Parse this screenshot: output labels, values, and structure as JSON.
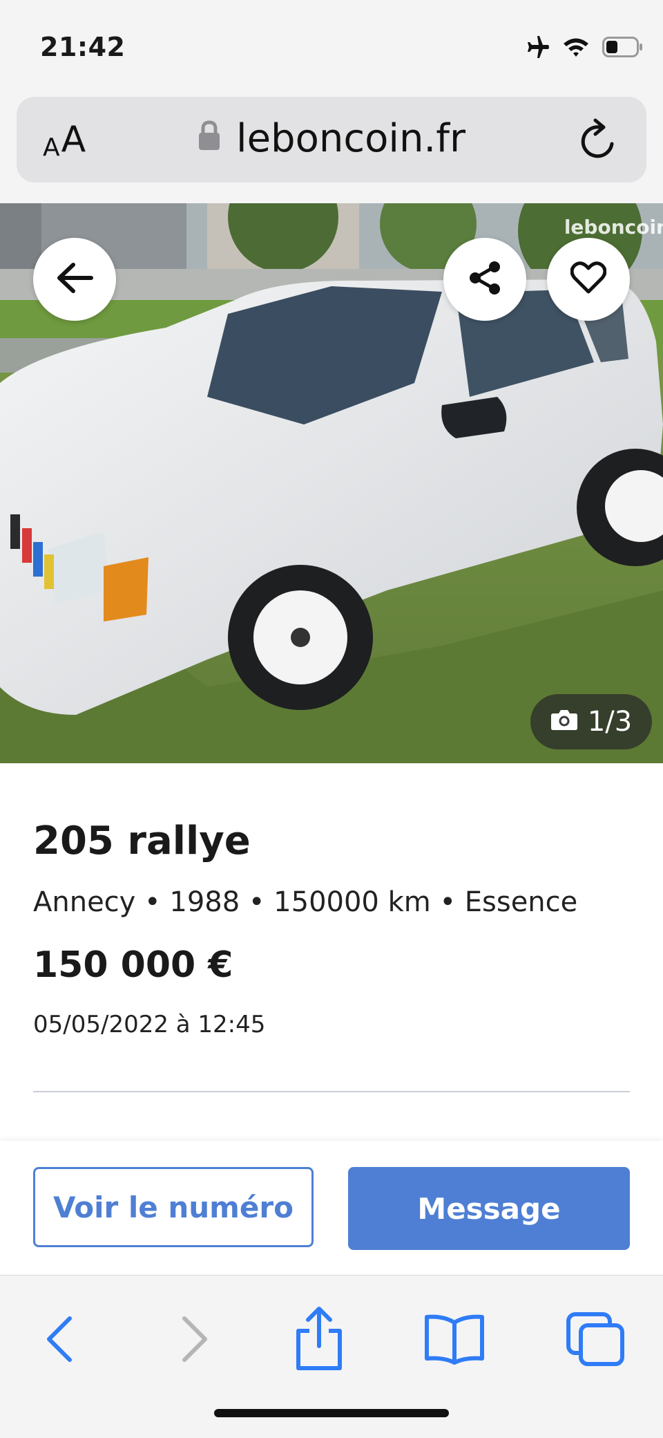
{
  "status_bar": {
    "time": "21:42"
  },
  "browser": {
    "text_size_small": "A",
    "text_size_big": "A",
    "domain": "leboncoin.fr"
  },
  "gallery": {
    "watermark": "leboncoin",
    "counter": "1/3"
  },
  "listing": {
    "title": "205 rallye",
    "meta": "Annecy • 1988 • 150000 km • Essence",
    "price": "150 000 €",
    "date": "05/05/2022 à 12:45"
  },
  "actions": {
    "show_number": "Voir le numéro",
    "message": "Message"
  },
  "colors": {
    "accent": "#4f7fd4",
    "toolbar_icon": "#2f7cf6",
    "toolbar_icon_disabled": "#b5b5b8"
  }
}
